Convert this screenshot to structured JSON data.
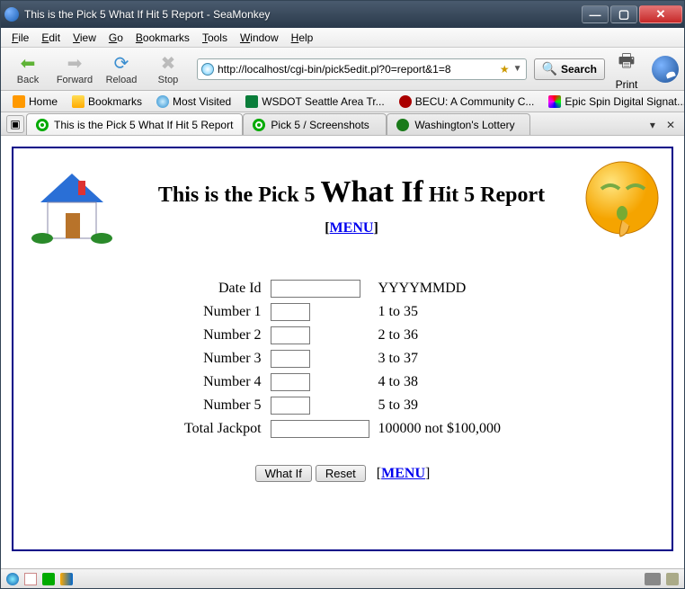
{
  "window": {
    "title": "This is the Pick 5 What If Hit 5 Report - SeaMonkey"
  },
  "menu": {
    "file": "File",
    "edit": "Edit",
    "view": "View",
    "go": "Go",
    "bookmarks": "Bookmarks",
    "tools": "Tools",
    "window": "Window",
    "help": "Help"
  },
  "nav": {
    "back": "Back",
    "forward": "Forward",
    "reload": "Reload",
    "stop": "Stop",
    "print": "Print",
    "search": "Search"
  },
  "url": {
    "value": "http://localhost/cgi-bin/pick5edit.pl?0=report&1=8"
  },
  "bookmarks": {
    "home": "Home",
    "bm": "Bookmarks",
    "mv": "Most Visited",
    "wsdot": "WSDOT Seattle Area Tr...",
    "becu": "BECU: A Community C...",
    "epic": "Epic Spin Digital Signat..."
  },
  "tabs": {
    "t1": "This is the Pick 5 What If Hit 5 Report",
    "t2": "Pick 5 / Screenshots",
    "t3": "Washington's Lottery"
  },
  "page": {
    "title_pre": "This is the Pick 5 ",
    "title_main": "What If",
    "title_post": " Hit 5 Report",
    "menu_label": "MENU",
    "formLabels": {
      "dateId": "Date Id",
      "n1": "Number 1",
      "n2": "Number 2",
      "n3": "Number 3",
      "n4": "Number 4",
      "n5": "Number 5",
      "jackpot": "Total Jackpot"
    },
    "hints": {
      "dateId": "YYYYMMDD",
      "n1": "1 to 35",
      "n2": "2 to 36",
      "n3": "3 to 37",
      "n4": "4 to 38",
      "n5": "5 to 39",
      "jackpot": "100000 not $100,000"
    },
    "buttons": {
      "whatif": "What If",
      "reset": "Reset"
    }
  }
}
